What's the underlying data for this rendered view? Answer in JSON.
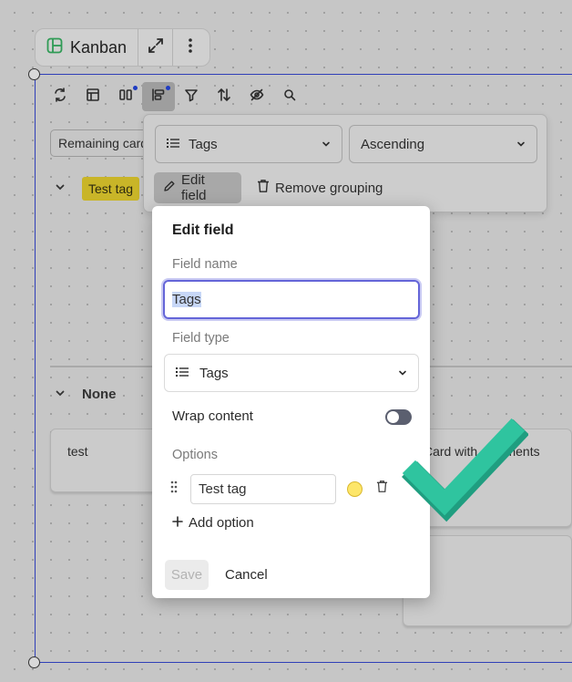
{
  "top_bar": {
    "title": "Kanban",
    "icons": [
      "kanban-icon",
      "expand-icon",
      "more-vertical-icon"
    ]
  },
  "toolbar": {
    "icons": [
      "refresh-icon",
      "layout-icon",
      "columns-icon",
      "group-icon",
      "filter-icon",
      "sort-icon",
      "hide-icon",
      "search-icon"
    ],
    "active": "group-icon"
  },
  "board": {
    "remaining_label": "Remaining cards",
    "groups": [
      {
        "label": "Test tag",
        "color": "#c9b528"
      },
      {
        "label": "None"
      }
    ],
    "cards": [
      {
        "text": "test"
      },
      {
        "text": "Card with comments"
      }
    ]
  },
  "grouping_popover": {
    "field": {
      "icon": "list-icon",
      "value": "Tags"
    },
    "order": {
      "value": "Ascending"
    },
    "edit_field_label": "Edit field",
    "remove_grouping_label": "Remove grouping"
  },
  "edit_field": {
    "title": "Edit field",
    "field_name_label": "Field name",
    "field_name_value": "Tags",
    "field_type_label": "Field type",
    "field_type_value": "Tags",
    "wrap_content_label": "Wrap content",
    "wrap_content_on": false,
    "options_label": "Options",
    "options": [
      {
        "value": "Test tag",
        "color": "#fde66a"
      }
    ],
    "add_option_label": "Add option",
    "save_label": "Save",
    "cancel_label": "Cancel"
  },
  "overlay": {
    "check_color": "#2fc49f"
  }
}
